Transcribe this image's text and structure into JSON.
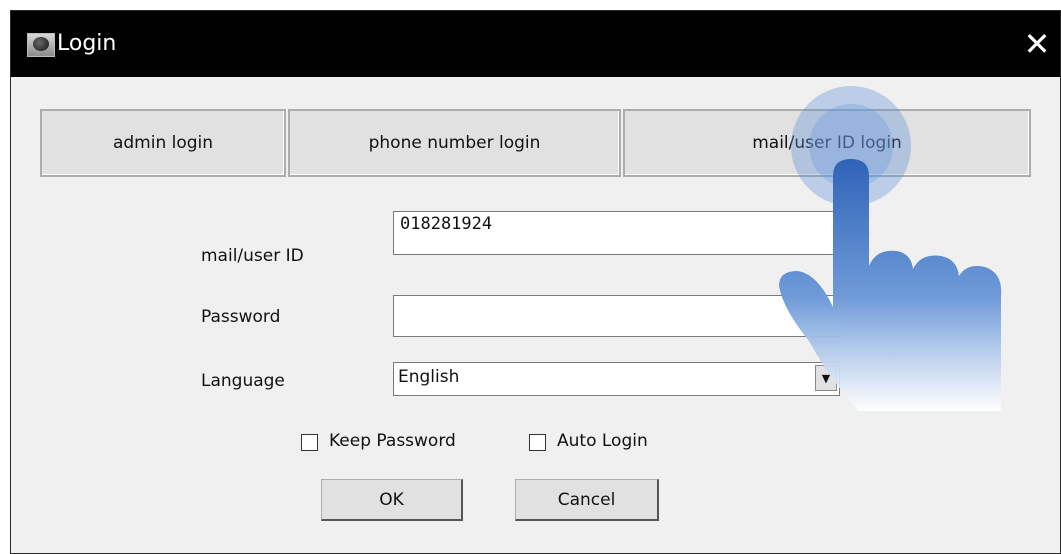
{
  "window": {
    "title": "Login",
    "close_glyph": "✕"
  },
  "tabs": [
    {
      "label": "admin login"
    },
    {
      "label": "phone number login"
    },
    {
      "label": "mail/user ID login"
    }
  ],
  "form": {
    "user_id_label": "mail/user ID",
    "user_id_value": "018281924",
    "password_label": "Password",
    "password_value": "",
    "language_label": "Language",
    "language_value": "English",
    "keep_password_label": "Keep Password",
    "keep_password_checked": false,
    "auto_login_label": "Auto Login",
    "auto_login_checked": false
  },
  "buttons": {
    "ok_label": "OK",
    "cancel_label": "Cancel"
  },
  "icons": {
    "app": "camera-icon",
    "close": "close-icon",
    "dropdown": "chevron-down-icon",
    "pointer": "hand-pointer-icon"
  },
  "colors": {
    "titlebar": "#000000",
    "window_bg": "#f0f0f0",
    "button_bg": "#e1e1e1",
    "hand_blue": "#3a6fc4"
  }
}
